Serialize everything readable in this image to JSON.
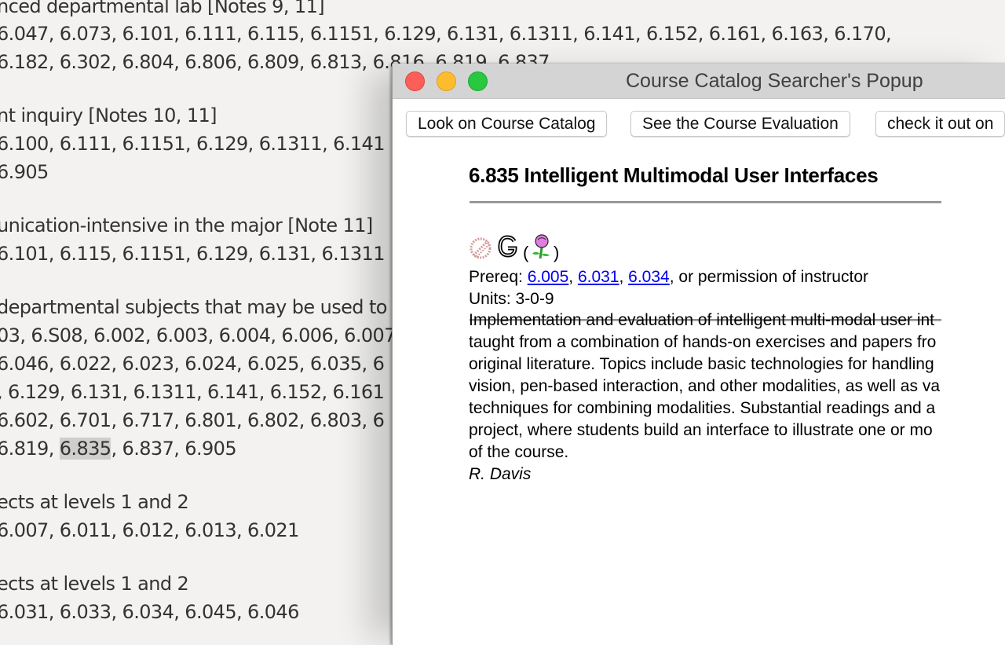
{
  "background_document": {
    "lines": [
      {
        "text": "nced departmental lab [Notes 9, 11]"
      },
      {
        "text": "6.047, 6.073, 6.101, 6.111, 6.115, 6.1151, 6.129, 6.131, 6.1311, 6.141, 6.152, 6.161, 6.163, 6.170,"
      },
      {
        "text": "6.182, 6.302, 6.804, 6.806, 6.809, 6.813, 6.816, 6.819, 6.837"
      },
      {
        "text": "nt inquiry [Notes 10, 11]"
      },
      {
        "text": "6.100, 6.111, 6.1151, 6.129, 6.1311, 6.141"
      },
      {
        "text": "6.905"
      },
      {
        "text": "unication-intensive in the major [Note 11]"
      },
      {
        "text": "6.101, 6.115, 6.1151, 6.129, 6.131, 6.1311"
      },
      {
        "text": "departmental subjects that may be used to"
      },
      {
        "text": "03, 6.S08, 6.002, 6.003, 6.004, 6.006, 6.007"
      },
      {
        "text": "6.046, 6.022, 6.023, 6.024, 6.025, 6.035, 6"
      },
      {
        "text": ", 6.129, 6.131, 6.1311, 6.141, 6.152, 6.161"
      },
      {
        "text": "6.602, 6.701, 6.717, 6.801, 6.802, 6.803, 6"
      },
      {
        "text_before": "6.819, ",
        "highlight": "6.835",
        "text_after": ", 6.837, 6.905"
      },
      {
        "text": "ects at levels 1 and 2"
      },
      {
        "text": "6.007, 6.011, 6.012, 6.013, 6.021"
      },
      {
        "text": "ects at levels 1 and 2"
      },
      {
        "text": "6.031, 6.033, 6.034, 6.045, 6.046"
      }
    ]
  },
  "popup": {
    "title": "Course Catalog Searcher's Popup",
    "window_controls": [
      "close",
      "minimize",
      "maximize"
    ],
    "toolbar": {
      "buttons": [
        {
          "label": "Look on Course Catalog"
        },
        {
          "label": "See the Course Evaluation"
        },
        {
          "label": "check it out on"
        }
      ]
    },
    "course": {
      "title": "6.835 Intelligent Multimodal User Interfaces",
      "icons": [
        "not-offered-icon",
        "graduate-icon",
        "spring-flower-icon"
      ],
      "paren_open": "(",
      "paren_close": ")",
      "prereq_label": "Prereq: ",
      "prereq_links": [
        "6.005",
        "6.031",
        "6.034"
      ],
      "prereq_sep": ", ",
      "prereq_tail": ", or permission of instructor",
      "units": "Units: 3-0-9",
      "description_lines": [
        "Implementation and evaluation of intelligent multi-modal user int",
        "taught from a combination of hands-on exercises and papers fro",
        "original literature. Topics include basic technologies for handling",
        "vision, pen-based interaction, and other modalities, as well as va",
        "techniques for combining modalities. Substantial readings and a",
        "project, where students build an interface to illustrate one or mo",
        "of the course."
      ],
      "instructor": "R. Davis"
    },
    "colors": {
      "link": "#0000ee",
      "close": "#fc5f57",
      "minimize": "#fdbc2e",
      "maximize": "#28c840",
      "highlight": "#cfcecc"
    }
  }
}
